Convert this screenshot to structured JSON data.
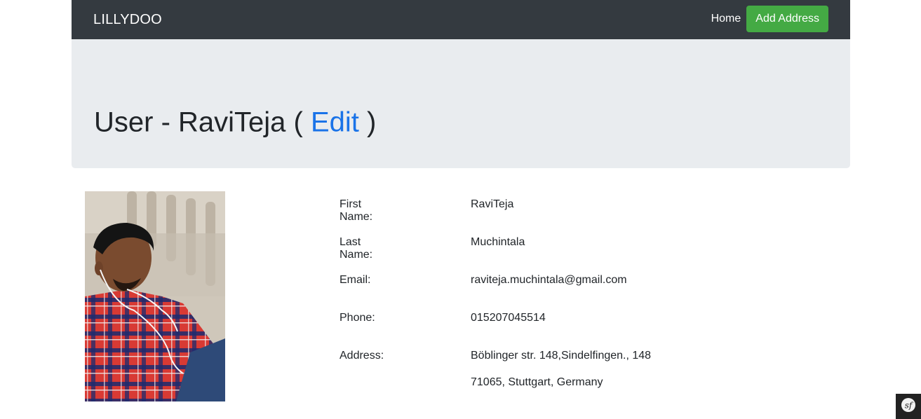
{
  "navbar": {
    "brand": "LILLYDOO",
    "home_label": "Home",
    "add_address_label": "Add Address"
  },
  "header": {
    "title_prefix": "User - RaviTeja (",
    "edit_label": "Edit",
    "title_suffix": ")"
  },
  "details": {
    "first_name": {
      "label": "First Name:",
      "value": "RaviTeja"
    },
    "last_name": {
      "label": "Last Name:",
      "value": "Muchintala"
    },
    "email": {
      "label": "Email:",
      "value": "raviteja.muchintala@gmail.com"
    },
    "phone": {
      "label": "Phone:",
      "value": "015207045514"
    },
    "address": {
      "label": "Address:",
      "line1": "Böblinger str. 148,Sindelfingen., 148",
      "line2": "71065, Stuttgart, Germany"
    }
  },
  "colors": {
    "navbar_bg": "#343a40",
    "jumbotron_bg": "#e9ecef",
    "accent_green": "#44aa44",
    "link_blue": "#1a73e8"
  },
  "icons": {
    "toolbar": "symfony-icon"
  }
}
